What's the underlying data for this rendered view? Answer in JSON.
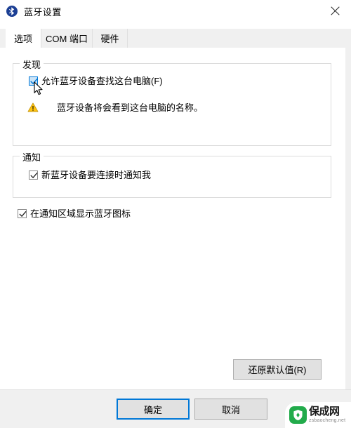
{
  "window": {
    "title": "蓝牙设置",
    "title_icon": "bluetooth-icon",
    "close_label": "✕"
  },
  "tabs": [
    {
      "label": "选项",
      "active": true
    },
    {
      "label": "COM 端口",
      "active": false
    },
    {
      "label": "硬件",
      "active": false
    }
  ],
  "groups": {
    "discovery": {
      "legend": "发现",
      "checkbox": {
        "label": "允许蓝牙设备查找这台电脑(F)",
        "checked": true,
        "state": "hover"
      },
      "warning": {
        "icon": "warning-triangle-icon",
        "text": "蓝牙设备将会看到这台电脑的名称。"
      }
    },
    "notification": {
      "legend": "通知",
      "checkbox": {
        "label": "新蓝牙设备要连接时通知我",
        "checked": true
      }
    }
  },
  "standalone_checkbox": {
    "label": "在通知区域显示蓝牙图标",
    "checked": true
  },
  "buttons": {
    "restore_defaults": "还原默认值(R)",
    "ok": "确定",
    "cancel": "取消"
  },
  "watermark": {
    "title": "保成网",
    "subtitle": "zsbaocheng.net"
  },
  "colors": {
    "accent": "#0078d7",
    "title_icon_bg": "#1c3f94",
    "warning": "#ffc20e",
    "watermark_green": "#22ab4b",
    "window_bg": "#ffffff",
    "chrome_bg": "#f0f0f0"
  }
}
